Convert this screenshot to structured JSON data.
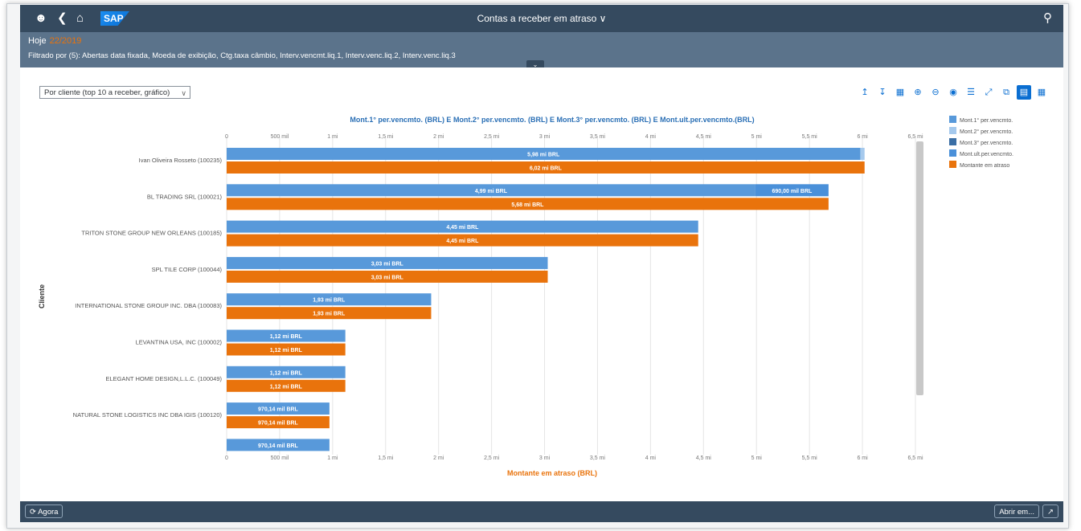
{
  "shell": {
    "title": "Contas a receber em atraso ∨",
    "logo": "SAP",
    "icons": [
      "user-icon",
      "back-icon",
      "home-icon",
      "search-icon"
    ]
  },
  "header": {
    "today_label": "Hoje",
    "today_value": "22/2019",
    "filter_text": "Filtrado por (5): Abertas data fixada, Moeda de exibição, Ctg.taxa câmbio, Interv.vencmt.liq.1, Interv.venc.liq.2, Interv.venc.liq.3"
  },
  "view_select": {
    "value": "Por cliente (top 10 a receber, gráfico)"
  },
  "toolbar": {
    "icons": [
      "drill-up-icon",
      "drill-down-icon",
      "legend-icon",
      "zoom-in-icon",
      "zoom-out-icon",
      "details-icon",
      "settings-icon",
      "fullscreen-icon",
      "export-icon",
      "chart-view-icon",
      "table-view-icon"
    ]
  },
  "chart_data": {
    "type": "bar",
    "title": "Mont.1° per.vencmto. (BRL) E Mont.2° per.vencmto. (BRL) E Mont.3° per.vencmto. (BRL) E Mont.ult.per.vencmto.(BRL)",
    "xlabel": "Montante em atraso (BRL)",
    "ylabel": "Cliente",
    "xlim": [
      0,
      6500000
    ],
    "tick_labels": [
      "0",
      "500 mil",
      "1 mi",
      "1,5 mi",
      "2 mi",
      "2,5 mi",
      "3 mi",
      "3,5 mi",
      "4 mi",
      "4,5 mi",
      "5 mi",
      "5,5 mi",
      "6 mi",
      "6,5 mi"
    ],
    "categories": [
      "Ivan Oliveira Rosseto (100235)",
      "BL TRADING SRL (100021)",
      "TRITON STONE GROUP NEW ORLEANS (100185)",
      "SPL TILE CORP (100044)",
      "INTERNATIONAL STONE GROUP INC. DBA (100083)",
      "LEVANTINA USA, INC (100002)",
      "ELEGANT HOME DESIGN,L.L.C. (100049)",
      "NATURAL STONE LOGISTICS INC DBA IGIS (100120)",
      ""
    ],
    "series": [
      {
        "name": "Mont.1° per.vencmto.",
        "color": "#5899da",
        "values": [
          5980000,
          4990000,
          4450000,
          3030000,
          1930000,
          1120000,
          1120000,
          970000,
          970000
        ],
        "labels": [
          "5,98 mi BRL",
          "4,99 mi BRL",
          "4,45 mi BRL",
          "3,03 mi BRL",
          "1,93 mi BRL",
          "1,12 mi BRL",
          "1,12 mi BRL",
          "970,14 mil BRL",
          "970,14 mil BRL"
        ]
      },
      {
        "name": "Mont.2° per.vencmto.",
        "color": "#a5c9ed",
        "values": [
          40000,
          0,
          0,
          0,
          0,
          0,
          0,
          0,
          0
        ],
        "labels": [
          "",
          "",
          "",
          "",
          "",
          "",
          "",
          "",
          ""
        ]
      },
      {
        "name": "Mont.3° per.vencmto.",
        "color": "#3a6ea5",
        "values": [
          0,
          0,
          0,
          0,
          0,
          0,
          0,
          0,
          0
        ],
        "labels": [
          "",
          "",
          "",
          "",
          "",
          "",
          "",
          "",
          ""
        ]
      },
      {
        "name": "Mont.ult.per.vencmto.",
        "color": "#4a90d9",
        "values": [
          0,
          690000,
          0,
          0,
          0,
          0,
          0,
          0,
          0
        ],
        "labels": [
          "",
          "690,00 mil BRL",
          "",
          "",
          "",
          "",
          "",
          "",
          ""
        ]
      },
      {
        "name": "Montante em atraso",
        "color": "#e9730c",
        "values": [
          6020000,
          5680000,
          4450000,
          3030000,
          1930000,
          1120000,
          1120000,
          970000,
          null
        ],
        "labels": [
          "6,02 mi BRL",
          "5,68 mi BRL",
          "4,45 mi BRL",
          "3,03 mi BRL",
          "1,93 mi BRL",
          "1,12 mi BRL",
          "1,12 mi BRL",
          "970,14 mil BRL",
          ""
        ]
      }
    ],
    "legend": [
      "Mont.1° per.vencmto.",
      "Mont.2° per.vencmto.",
      "Mont.3° per.vencmto.",
      "Mont.ult.per.vencmto.",
      "Montante em atraso"
    ],
    "legend_position": "right",
    "grid": true
  },
  "footer": {
    "refresh_label": "Agora",
    "open_label": "Abrir em..."
  }
}
